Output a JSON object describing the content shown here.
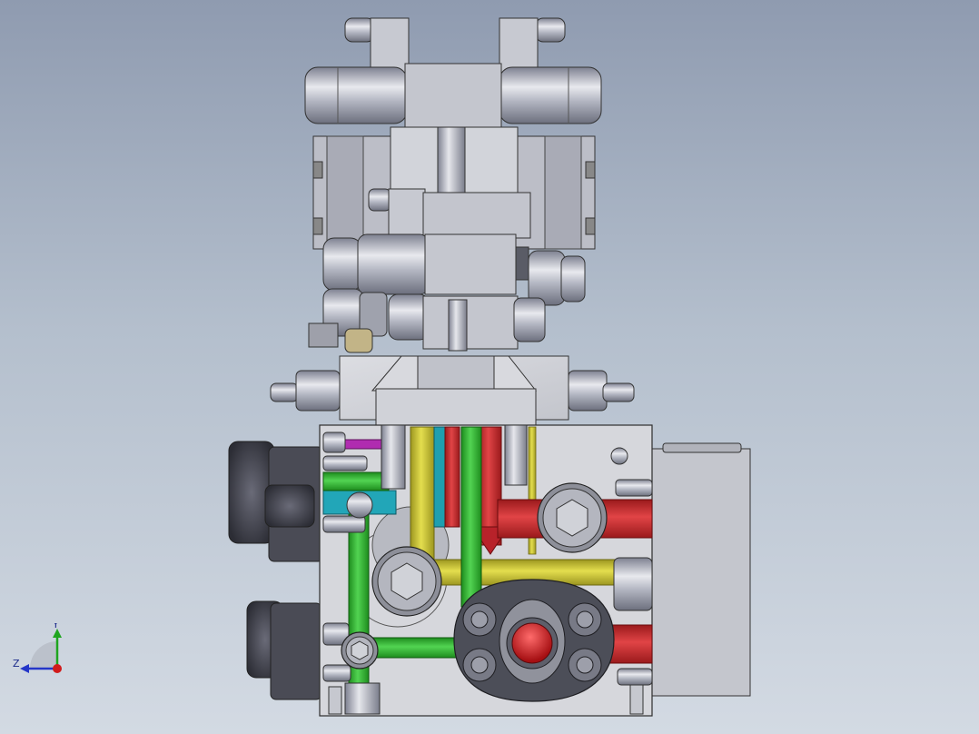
{
  "viewport": {
    "colors": {
      "background_top": "#8f9bb0",
      "background_bottom": "#d3dae3",
      "metal": "#b9bcc6",
      "block": "#d4d5da",
      "channel_green": "#2fb52f",
      "channel_yellow": "#c8c230",
      "channel_red": "#c8282b",
      "channel_cyan": "#22a6b8",
      "channel_magenta": "#b02cb0",
      "knob_dark": "#3e3f48"
    },
    "icons": [
      "hex-socket-screw-icon",
      "red-port-icon",
      "orientation-triad-icon"
    ]
  },
  "triad": {
    "y_label": "Y",
    "z_label": "Z",
    "colors": {
      "y": "#1fa51f",
      "z": "#2436c8",
      "x": "#d11b1b"
    }
  }
}
